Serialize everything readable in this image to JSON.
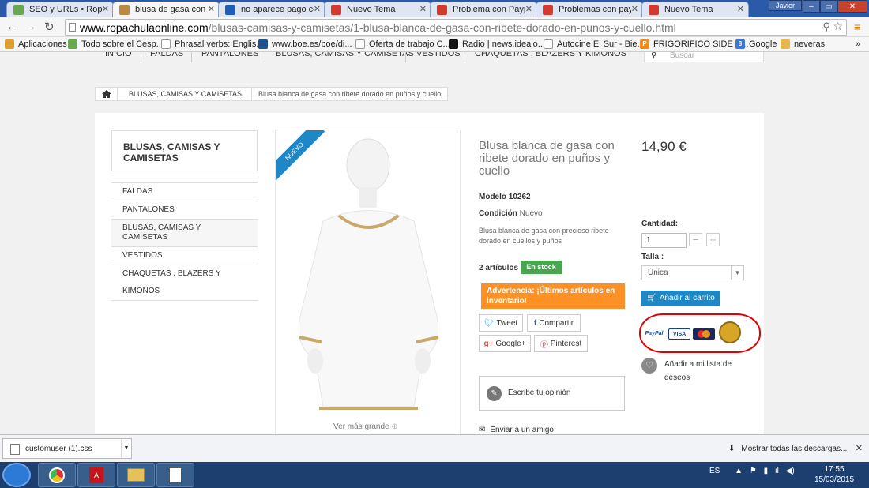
{
  "browser": {
    "tabs": [
      {
        "label": "SEO y URLs • Ropa C",
        "favicon": "shirt-icon",
        "color": "#6aa84f"
      },
      {
        "label": "blusa de gasa con ri",
        "favicon": "hanger-icon",
        "color": "#b88a42",
        "active": true
      },
      {
        "label": "no aparece pago cor",
        "favicon": "prestashop-icon",
        "color": "#1e5db8"
      },
      {
        "label": "Nuevo Tema",
        "favicon": "w-icon",
        "color": "#d13c2f"
      },
      {
        "label": "Problema con Paypa",
        "favicon": "w-icon",
        "color": "#d13c2f"
      },
      {
        "label": "Problemas con payp",
        "favicon": "w-icon",
        "color": "#d13c2f"
      },
      {
        "label": "Nuevo Tema",
        "favicon": "w-icon",
        "color": "#d13c2f"
      }
    ],
    "user": "Javier",
    "url_host": "www.ropachulaonline.com",
    "url_path": "/blusas-camisas-y-camisetas/1-blusa-blanca-de-gasa-con-ribete-dorado-en-punos-y-cuello.html",
    "bookmarks": [
      "Aplicaciones",
      "Todo sobre el Cesp...",
      "Phrasal verbs: Englis...",
      "www.boe.es/boe/di...",
      "Oferta de trabajo C...",
      "Radio | news.idealo....",
      "Autocine El Sur - Bie...",
      "FRIGORIFICO SIDE B...",
      "Google",
      "neveras"
    ],
    "more": "»"
  },
  "site": {
    "nav": [
      "INICIO",
      "FALDAS",
      "PANTALONES",
      "BLUSAS, CAMISAS Y CAMISETAS",
      "VESTIDOS",
      "CHAQUETAS , BLAZERS Y KIMONOS"
    ],
    "search_placeholder": "Buscar",
    "breadcrumb": {
      "category": "BLUSAS, CAMISAS Y CAMISETAS",
      "current": "Blusa blanca de gasa con ribete dorado en puños y cuello"
    },
    "sidebar": {
      "title": "BLUSAS, CAMISAS Y CAMISETAS",
      "items": [
        "FALDAS",
        "PANTALONES",
        "BLUSAS, CAMISAS Y CAMISETAS",
        "VESTIDOS",
        "CHAQUETAS , BLAZERS Y KIMONOS"
      ]
    },
    "product": {
      "badge": "NUEVO",
      "view_larger": "Ver más grande",
      "title": "Blusa blanca de gasa con ribete dorado en puños y cuello",
      "model_label": "Modelo",
      "model_value": "10262",
      "condition_label": "Condición",
      "condition_value": "Nuevo",
      "description": "Blusa blanca de gasa con precioso ribete dorado en cuellos y puños",
      "stock_count": "2 artículos",
      "stock_status": "En stock",
      "warning": "Advertencia: ¡Últimos artículos en inventario!",
      "share": [
        "Tweet",
        "Compartir",
        "Google+",
        "Pinterest"
      ],
      "review": "Escribe tu opinión",
      "send_friend": "Enviar a un amigo",
      "price": "14,90 €",
      "quantity_label": "Cantidad:",
      "quantity_value": "1",
      "size_label": "Talla :",
      "size_value": "Única",
      "add_to_cart": "Añadir al carrito",
      "payment_logos": [
        "PayPal",
        "VISA",
        "MasterCard"
      ],
      "wishlist": "Añadir a mi lista de deseos"
    }
  },
  "downloads": {
    "file": "customuser (1).css",
    "show_all": "Mostrar todas las descargas..."
  },
  "taskbar": {
    "lang": "ES",
    "time": "17:55",
    "date": "15/03/2015"
  }
}
